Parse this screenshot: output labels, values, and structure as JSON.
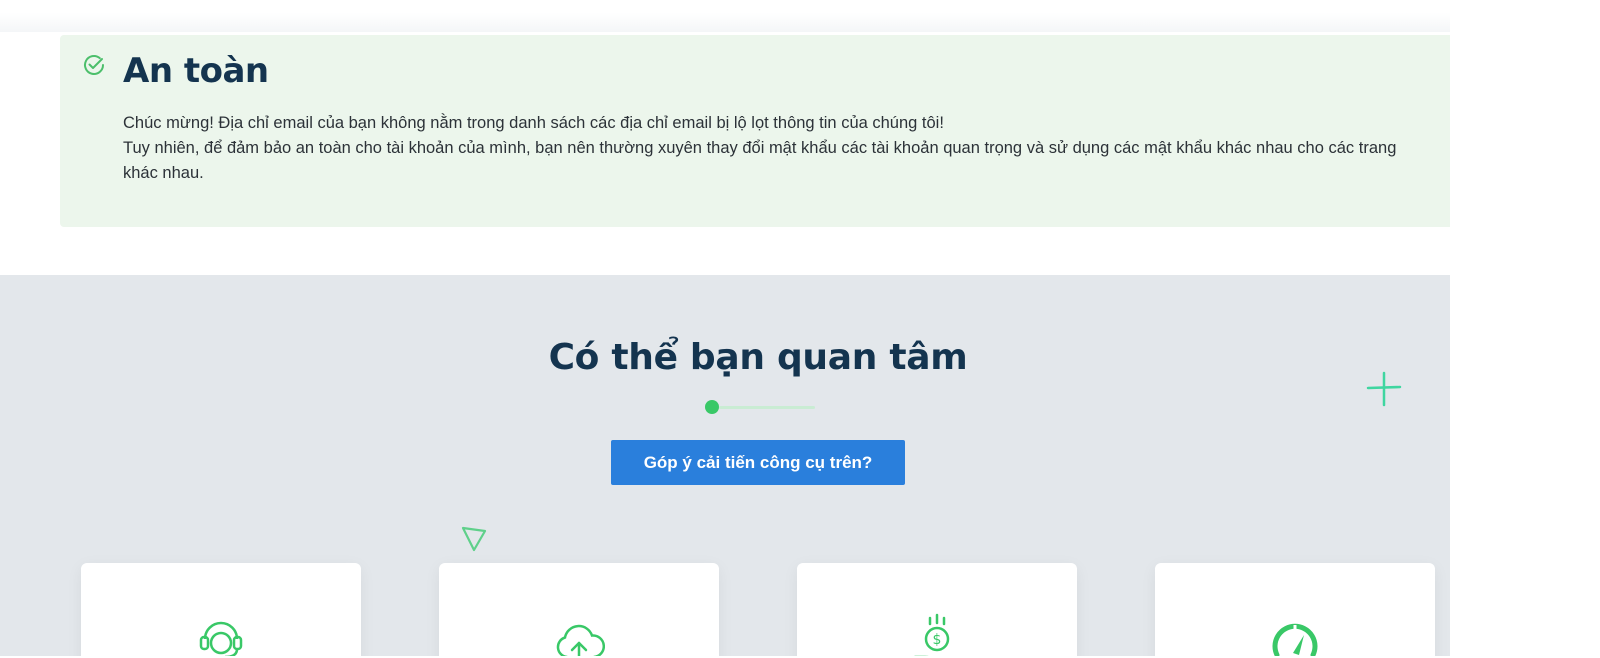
{
  "alert": {
    "status_icon": "check-circle-icon",
    "title": "An toàn",
    "line1": "Chúc mừng! Địa chỉ email của bạn không nằm trong danh sách các địa chỉ email bị lộ lọt thông tin của chúng tôi!",
    "line2": "Tuy nhiên, để đảm bảo an toàn cho tài khoản của mình, bạn nên thường xuyên thay đổi mật khẩu các tài khoản quan trọng và sử dụng các mật khẩu khác nhau cho các trang khác nhau."
  },
  "section": {
    "title": "Có thể bạn quan tâm",
    "button_label": "Góp ý cải tiến công cụ trên?",
    "cards": [
      {
        "icon": "support-agent-icon"
      },
      {
        "icon": "cloud-upload-icon"
      },
      {
        "icon": "money-coin-icon"
      },
      {
        "icon": "speedometer-icon"
      }
    ]
  },
  "colors": {
    "accent_green": "#39c867",
    "alert_bg": "#ecf6ec",
    "title_navy": "#14344f",
    "button_blue": "#2a7fdc",
    "section_bg": "#e3e7eb"
  }
}
